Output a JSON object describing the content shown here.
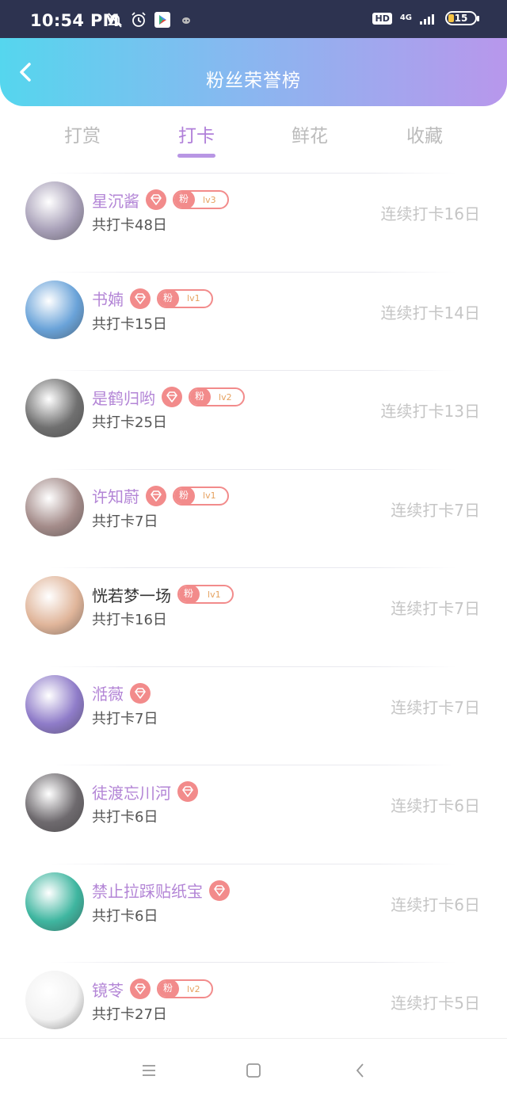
{
  "status_bar": {
    "time": "10:54 PM",
    "hd": "HD",
    "network": "4G",
    "battery": "15"
  },
  "header": {
    "title": "粉丝荣誉榜"
  },
  "tabs": [
    {
      "label": "打赏",
      "active": false
    },
    {
      "label": "打卡",
      "active": true
    },
    {
      "label": "鲜花",
      "active": false
    },
    {
      "label": "收藏",
      "active": false
    }
  ],
  "list": [
    {
      "name": "星沉酱",
      "diamond": true,
      "fan_label": "粉",
      "level": "lv3",
      "total": "共打卡48日",
      "streak": "连续打卡16日",
      "avatar_color": "#a8a0b8"
    },
    {
      "name": "书婻",
      "diamond": true,
      "fan_label": "粉",
      "level": "lv1",
      "total": "共打卡15日",
      "streak": "连续打卡14日",
      "avatar_color": "#6aa3d9"
    },
    {
      "name": "是鹤归哟",
      "diamond": true,
      "fan_label": "粉",
      "level": "lv2",
      "total": "共打卡25日",
      "streak": "连续打卡13日",
      "avatar_color": "#707070"
    },
    {
      "name": "许知蔚",
      "diamond": true,
      "fan_label": "粉",
      "level": "lv1",
      "total": "共打卡7日",
      "streak": "连续打卡7日",
      "avatar_color": "#a48c8a"
    },
    {
      "name": "恍若梦一场",
      "diamond": false,
      "fan_label": "粉",
      "level": "lv1",
      "total": "共打卡16日",
      "streak": "连续打卡7日",
      "avatar_color": "#e0b59a"
    },
    {
      "name": "湉薇",
      "diamond": true,
      "fan_label": "",
      "level": "",
      "total": "共打卡7日",
      "streak": "连续打卡7日",
      "avatar_color": "#8f7cc9"
    },
    {
      "name": "徒渡忘川河",
      "diamond": true,
      "fan_label": "",
      "level": "",
      "total": "共打卡6日",
      "streak": "连续打卡6日",
      "avatar_color": "#6e6a6e"
    },
    {
      "name": "禁止拉踩贴纸宝",
      "diamond": true,
      "fan_label": "",
      "level": "",
      "total": "共打卡6日",
      "streak": "连续打卡6日",
      "avatar_color": "#3fb6a0"
    },
    {
      "name": "镜苓",
      "diamond": true,
      "fan_label": "粉",
      "level": "lv2",
      "total": "共打卡27日",
      "streak": "连续打卡5日",
      "avatar_color": "#f2f2f2"
    }
  ],
  "colors": {
    "accent": "#b385d6",
    "badge": "#f28b8b",
    "header_gradient_start": "#55d6ee",
    "header_gradient_end": "#b897ec"
  }
}
